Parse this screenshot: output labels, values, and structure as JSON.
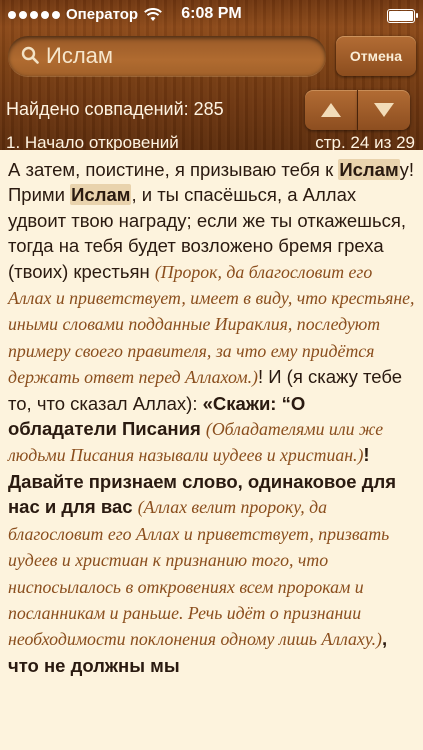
{
  "status": {
    "carrier": "Оператор",
    "time": "6:08 PM"
  },
  "search": {
    "query": "Ислам",
    "cancel_label": "Отмена"
  },
  "results": {
    "found_text": "Найдено совпадений: 285"
  },
  "header": {
    "chapter": "1. Начало откровений",
    "page": "стр. 24 из 29"
  },
  "content": {
    "t1": "А затем, поистине, я призываю тебя к ",
    "h1": "Ислам",
    "t2": "у! Прими ",
    "h2": "Ислам",
    "t3": ", и ты спасёшься, а Аллах удвоит твою награду; если же ты откажешься, тогда на тебя будет возложено бремя греха (твоих) крестьян ",
    "c1": "(Пророк, да благословит его Аллах и приветствует, имеет в виду, что крестьяне, иными словами подданные Иираклия, последуют примеру своего правителя, за что ему придётся держать ответ перед Аллахом.)",
    "t4": "! И (я скажу тебе то, что сказал Аллах): ",
    "q1": "«Скажи: “О обладатели Писания ",
    "c2": "(Обладателями или же людьми Писания называли иудеев и христиан.)",
    "q2": "! Давайте признаем слово, одинаковое для нас и для вас ",
    "c3": "(Аллах велит пророку, да благословит его Аллах и приветствует, призвать иудеев и христиан к признанию того, что ниспосылалось в откровениях всем пророкам и посланникам и раньше. Речь идёт о признании необходимости поклонения одному лишь Аллаху.)",
    "q3": ", что не должны мы"
  }
}
